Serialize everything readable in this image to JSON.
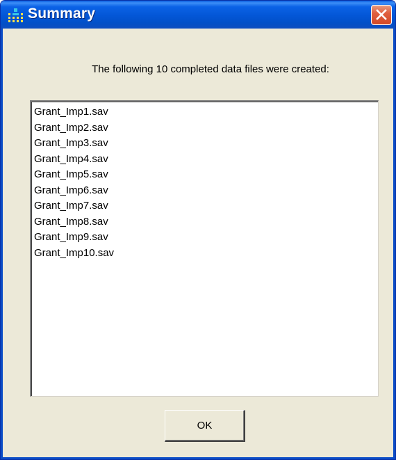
{
  "window": {
    "title": "Summary",
    "title_icon": "app-icon",
    "close_icon": "close-icon",
    "titlebar_color": "#0356d6",
    "close_color": "#d24a28"
  },
  "message": "The following 10 completed data files were created:",
  "files": [
    "Grant_Imp1.sav",
    "Grant_Imp2.sav",
    "Grant_Imp3.sav",
    "Grant_Imp4.sav",
    "Grant_Imp5.sav",
    "Grant_Imp6.sav",
    "Grant_Imp7.sav",
    "Grant_Imp8.sav",
    "Grant_Imp9.sav",
    "Grant_Imp10.sav"
  ],
  "buttons": {
    "ok_label": "OK"
  }
}
